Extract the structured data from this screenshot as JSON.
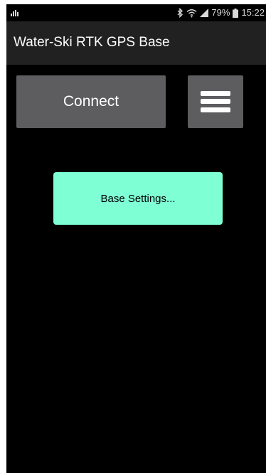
{
  "status_bar": {
    "battery_percent": "79%",
    "time": "15:22",
    "icons": [
      "signal-bars-icon",
      "bluetooth-icon",
      "wifi-icon",
      "cell-signal-icon",
      "battery-icon"
    ]
  },
  "app_bar": {
    "title": "Water-Ski RTK GPS Base"
  },
  "main": {
    "connect_label": "Connect",
    "menu_icon": "hamburger-menu-icon",
    "base_settings_label": "Base Settings..."
  },
  "colors": {
    "background": "#000000",
    "app_bar": "#212121",
    "button_gray": "#5d5d5f",
    "accent_mint": "#7effd4",
    "text_white": "#ffffff"
  }
}
